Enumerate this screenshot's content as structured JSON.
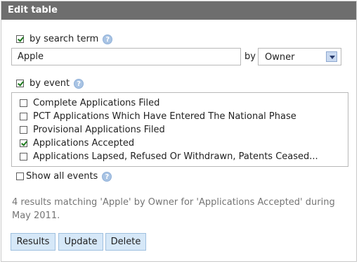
{
  "header": {
    "title": "Edit table"
  },
  "search_filter": {
    "label": "by search term",
    "checked": true,
    "help_icon": "help-icon",
    "input_value": "Apple",
    "by_label": "by",
    "field_select": {
      "selected": "Owner"
    }
  },
  "event_filter": {
    "label": "by event",
    "checked": true,
    "help_icon": "help-icon",
    "events": [
      {
        "label": "Complete Applications Filed",
        "checked": false
      },
      {
        "label": "PCT Applications Which Have Entered The National Phase",
        "checked": false
      },
      {
        "label": "Provisional Applications Filed",
        "checked": false
      },
      {
        "label": "Applications Accepted",
        "checked": true
      },
      {
        "label": "Applications Lapsed, Refused Or Withdrawn, Patents Ceased...",
        "checked": false
      }
    ],
    "show_all": {
      "label": "Show all events",
      "checked": false
    }
  },
  "status_text": "4 results matching 'Apple' by Owner for 'Applications Accepted' during May 2011.",
  "buttons": {
    "results": "Results",
    "update": "Update",
    "delete": "Delete"
  }
}
